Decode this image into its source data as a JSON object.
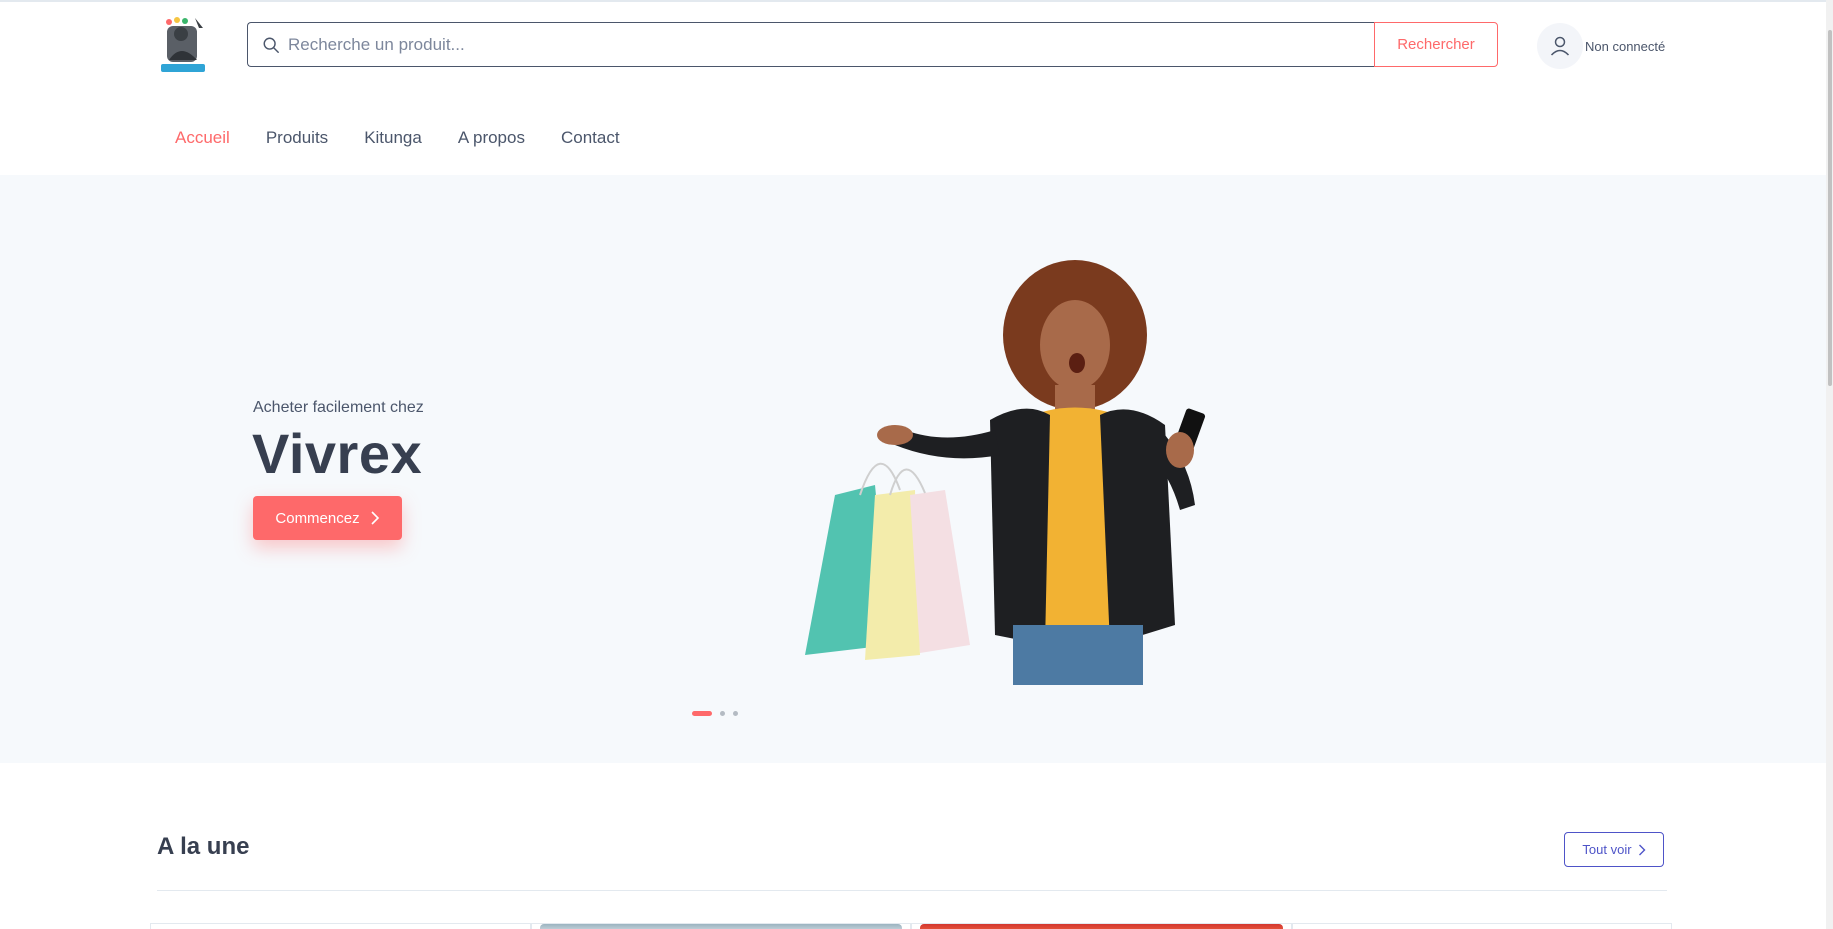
{
  "header": {
    "search": {
      "placeholder": "Recherche un produit...",
      "button_label": "Rechercher"
    },
    "account": {
      "label": "Non connecté"
    },
    "logo": {
      "alt": "Vivrex"
    }
  },
  "nav": {
    "items": [
      "Accueil",
      "Produits",
      "Kitunga",
      "A propos",
      "Contact"
    ],
    "active_index": 0
  },
  "hero": {
    "subtitle": "Acheter facilement chez",
    "title": "Vivrex",
    "cta_label": "Commencez",
    "slide_count": 3,
    "active_slide": 0
  },
  "featured": {
    "title": "A la une",
    "see_all_label": "Tout voir"
  },
  "colors": {
    "accent": "#fe696a",
    "text_dark": "#373f50",
    "link_secondary": "#4e54c8",
    "hero_bg": "#f6f9fc"
  }
}
